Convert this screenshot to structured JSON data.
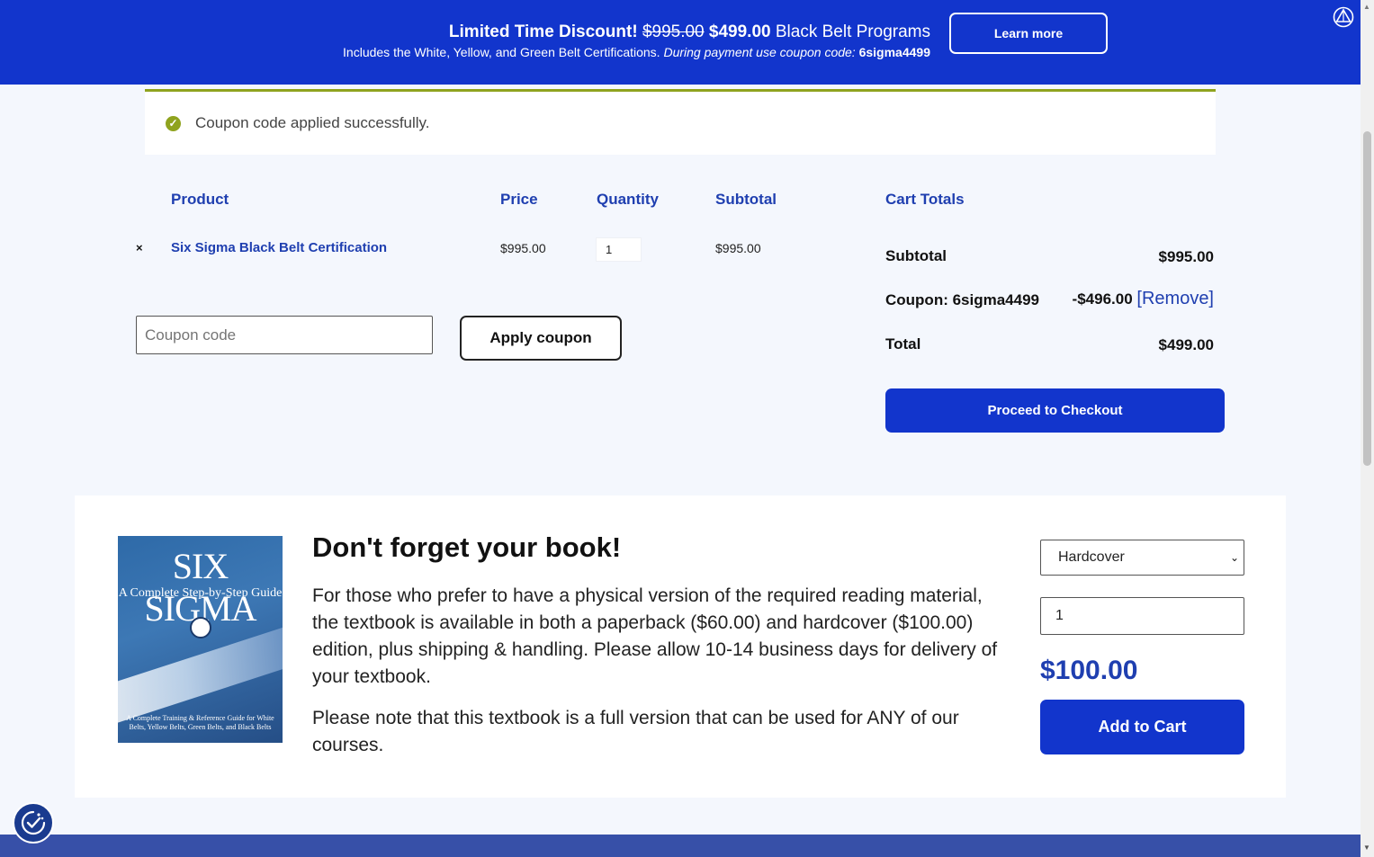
{
  "banner": {
    "headline_bold": "Limited Time Discount!",
    "old_price": "$995.00",
    "new_price": "$499.00",
    "headline_rest": "Black Belt Programs",
    "subline": "Includes the White, Yellow, and Green Belt Certifications.",
    "subline_italic": "During payment use coupon code:",
    "coupon_code": "6sigma4499",
    "learn_more_label": "Learn more",
    "background_color": "#1235cc"
  },
  "notice": {
    "icon": "check-circle-icon",
    "message": "Coupon code applied successfully.",
    "accent_color": "#8fa31e"
  },
  "cart": {
    "headers": {
      "product": "Product",
      "price": "Price",
      "quantity": "Quantity",
      "subtotal": "Subtotal"
    },
    "items": [
      {
        "remove_symbol": "×",
        "name": "Six Sigma Black Belt Certification",
        "price": "$995.00",
        "quantity": "1",
        "subtotal": "$995.00"
      }
    ],
    "coupon_placeholder": "Coupon code",
    "apply_coupon_label": "Apply coupon"
  },
  "totals": {
    "title": "Cart Totals",
    "subtotal_label": "Subtotal",
    "subtotal_value": "$995.00",
    "coupon_label": "Coupon: 6sigma4499",
    "coupon_value": "-$496.00",
    "coupon_remove": "[Remove]",
    "total_label": "Total",
    "total_value": "$499.00",
    "checkout_label": "Proceed to Checkout"
  },
  "book": {
    "cover_title": "SIX SIGMA",
    "cover_subtitle": "A Complete Step-by-Step Guide",
    "cover_footer": "A Complete Training & Reference Guide for White Belts, Yellow Belts, Green Belts, and Black Belts",
    "heading": "Don't forget your book!",
    "paragraph1": "For those who prefer to have a physical version of the required reading material, the textbook is available in both a paperback ($60.00) and hardcover ($100.00) edition, plus shipping & handling. Please allow 10-14 business days for delivery of your textbook.",
    "paragraph2": "Please note that this textbook is a full version that can be used for ANY of our courses.",
    "format_selected": "Hardcover",
    "quantity": "1",
    "price": "$100.00",
    "add_to_cart_label": "Add to Cart"
  },
  "colors": {
    "primary": "#1235cc",
    "link": "#1f3fb0",
    "page_bg": "#f4f7fd",
    "footer": "#3750a8"
  }
}
